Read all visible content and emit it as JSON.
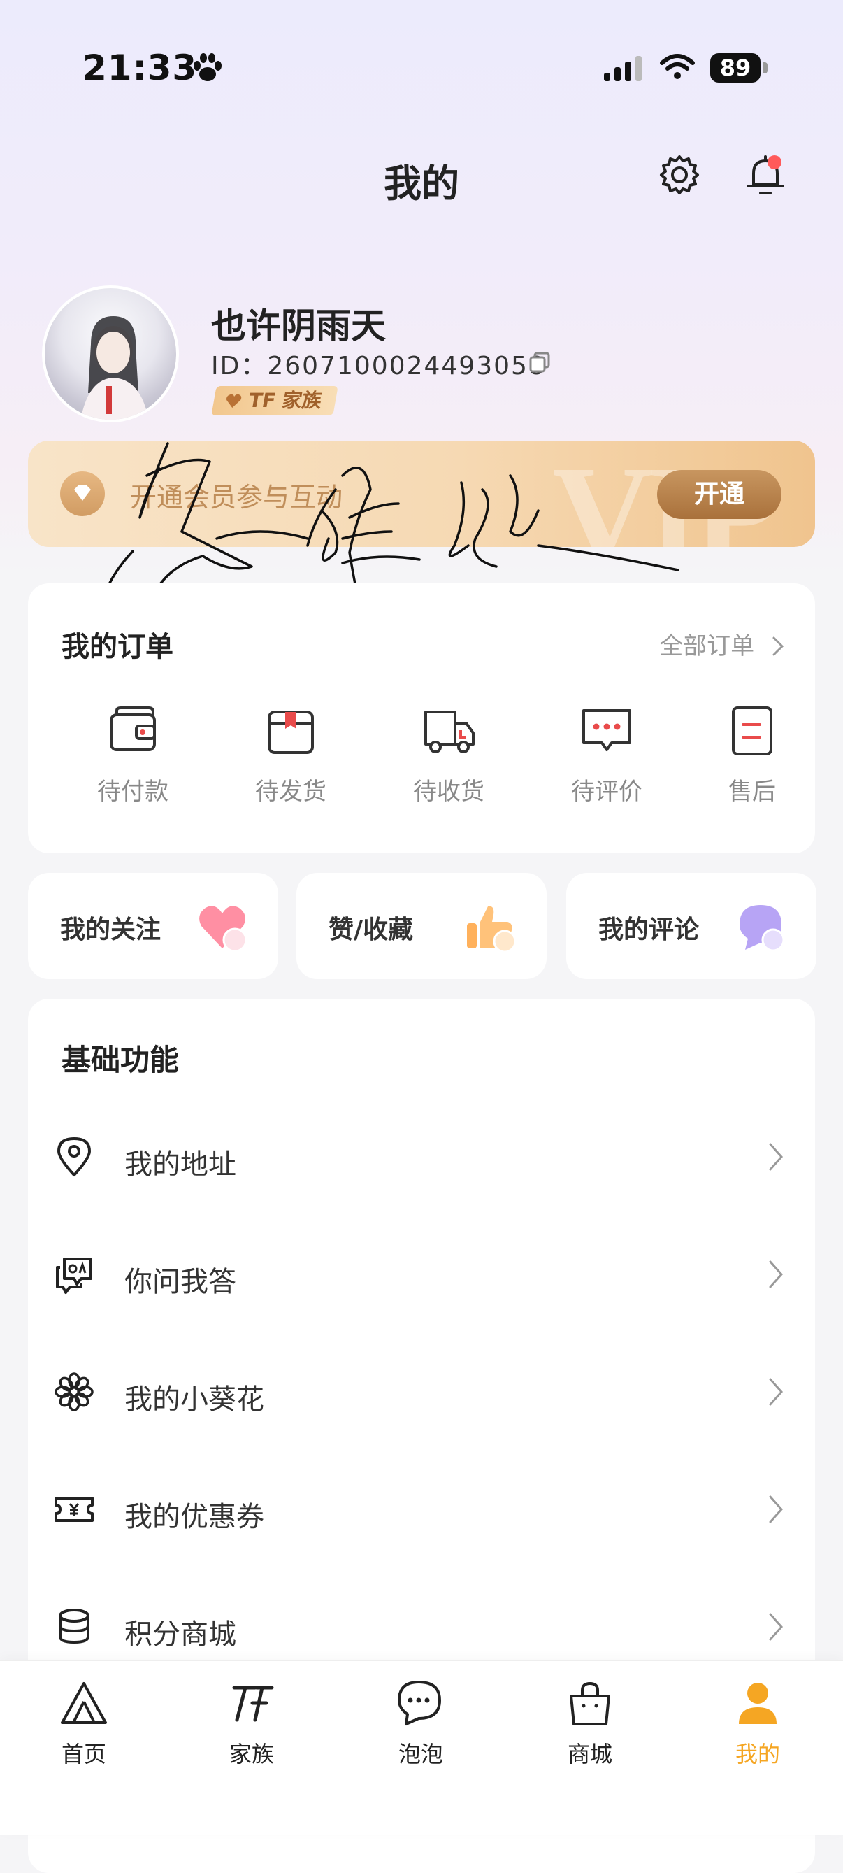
{
  "status_bar": {
    "time": "21:33",
    "battery": "89"
  },
  "header": {
    "title": "我的"
  },
  "profile": {
    "username": "也许阴雨天",
    "user_id": "ID：2607100024493058",
    "badge": "TF 家族"
  },
  "vip": {
    "text": "开通会员参与互动",
    "button": "开通",
    "watermark": "VIP"
  },
  "orders": {
    "title": "我的订单",
    "all_label": "全部订单",
    "items": [
      {
        "label": "待付款",
        "icon": "wallet-icon"
      },
      {
        "label": "待发货",
        "icon": "package-icon"
      },
      {
        "label": "待收货",
        "icon": "truck-icon"
      },
      {
        "label": "待评价",
        "icon": "comment-icon"
      },
      {
        "label": "售后",
        "icon": "after-sale-icon"
      }
    ]
  },
  "quick": [
    {
      "label": "我的关注",
      "icon": "heart-icon"
    },
    {
      "label": "赞/收藏",
      "icon": "thumbs-up-icon"
    },
    {
      "label": "我的评论",
      "icon": "chat-bubble-icon"
    }
  ],
  "functions": {
    "title": "基础功能",
    "items": [
      {
        "label": "我的地址",
        "icon": "location-icon"
      },
      {
        "label": "你问我答",
        "icon": "qa-icon"
      },
      {
        "label": "我的小葵花",
        "icon": "flower-icon"
      },
      {
        "label": "我的优惠券",
        "icon": "coupon-icon"
      },
      {
        "label": "积分商城",
        "icon": "coins-icon"
      }
    ]
  },
  "tabs": [
    {
      "label": "首页",
      "icon": "home-icon"
    },
    {
      "label": "家族",
      "icon": "tf-family-icon"
    },
    {
      "label": "泡泡",
      "icon": "bubble-icon"
    },
    {
      "label": "商城",
      "icon": "shopping-bag-icon"
    },
    {
      "label": "我的",
      "icon": "user-icon",
      "active": true
    }
  ],
  "colors": {
    "accent": "#f5a623",
    "vip_button": "#b98248",
    "notification_dot": "#ff5a5a"
  }
}
